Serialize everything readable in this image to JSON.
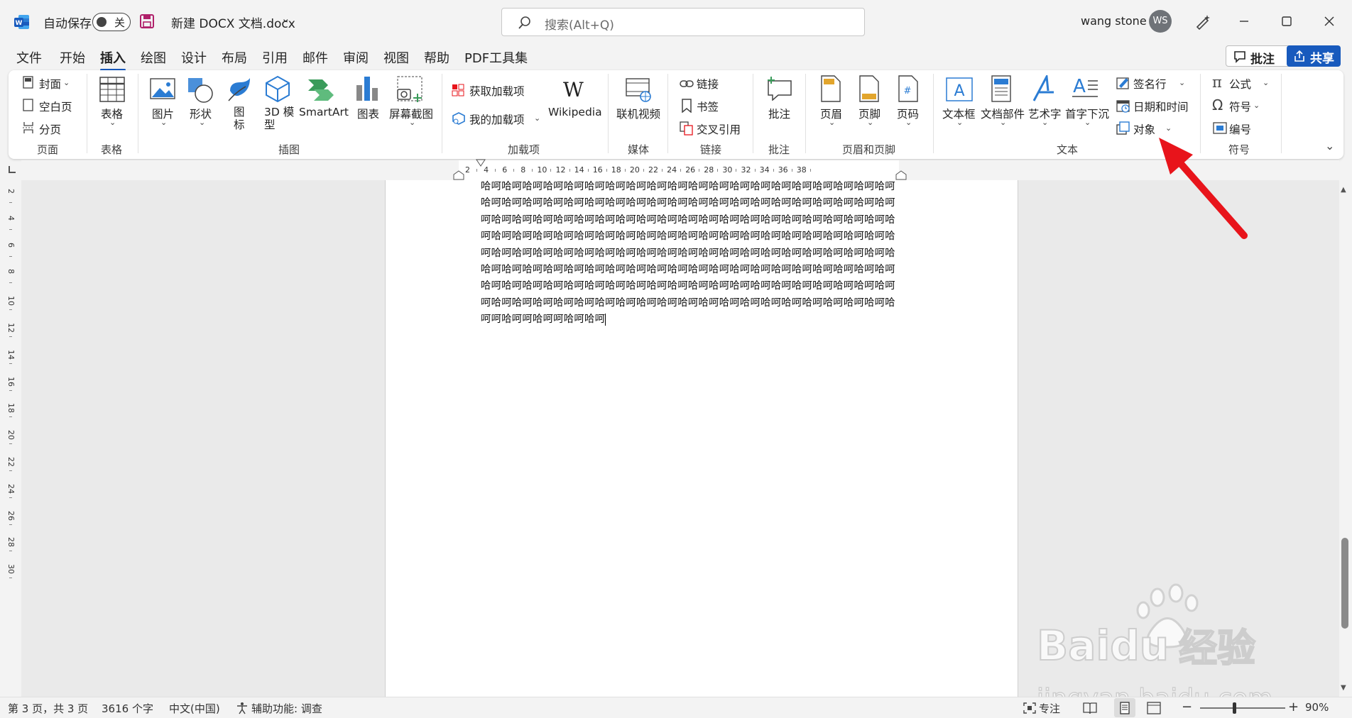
{
  "title_bar": {
    "autosave_label": "自动保存",
    "autosave_state": "关",
    "document_name": "新建 DOCX 文档.docx",
    "search_placeholder": "搜索(Alt+Q)",
    "user_name": "wang stone",
    "user_initials": "WS"
  },
  "menu_tabs": [
    "文件",
    "开始",
    "插入",
    "绘图",
    "设计",
    "布局",
    "引用",
    "邮件",
    "审阅",
    "视图",
    "帮助",
    "PDF工具集"
  ],
  "active_tab": "插入",
  "header_buttons": {
    "comment": "批注",
    "share": "共享"
  },
  "ribbon": {
    "pages": {
      "cover": "封面",
      "blank": "空白页",
      "break": "分页",
      "group": "页面"
    },
    "tables": {
      "table": "表格",
      "group": "表格"
    },
    "illustrations": {
      "picture": "图片",
      "shapes": "形状",
      "icons": "图\n标",
      "model3d": "3D 模\n型",
      "smartart": "SmartArt",
      "chart": "图表",
      "screenshot": "屏幕截图",
      "group": "插图"
    },
    "addins": {
      "get": "获取加载项",
      "my": "我的加载项",
      "wikipedia": "Wikipedia",
      "group": "加载项"
    },
    "media": {
      "video": "联机视频",
      "group": "媒体"
    },
    "links": {
      "link": "链接",
      "bookmark": "书签",
      "crossref": "交叉引用",
      "group": "链接"
    },
    "comments": {
      "comment": "批注",
      "group": "批注"
    },
    "header_footer": {
      "header": "页眉",
      "footer": "页脚",
      "page_number": "页码",
      "group": "页眉和页脚"
    },
    "text": {
      "textbox": "文本框",
      "quickparts": "文档部件",
      "wordart": "艺术字",
      "dropcap": "首字下沉",
      "signature": "签名行",
      "datetime": "日期和时间",
      "object": "对象",
      "group": "文本"
    },
    "symbols": {
      "equation": "公式",
      "symbol": "符号",
      "number": "编号",
      "group": "符号"
    }
  },
  "ruler": {
    "h_ticks": [
      "2",
      "4",
      "6",
      "8",
      "10",
      "12",
      "14",
      "16",
      "18",
      "20",
      "22",
      "24",
      "26",
      "28",
      "30",
      "32",
      "34",
      "36",
      "38"
    ],
    "v_ticks": [
      "2",
      "4",
      "6",
      "8",
      "10",
      "12",
      "14",
      "16",
      "18",
      "20",
      "22",
      "24",
      "26",
      "28",
      "30"
    ]
  },
  "document": {
    "lines": [
      "哈呵哈呵哈呵哈呵哈呵哈呵哈呵哈呵哈呵哈呵哈呵哈呵哈呵哈呵哈呵哈呵哈呵哈呵哈呵哈呵",
      "哈呵哈呵哈呵哈呵哈呵哈呵哈呵哈呵哈呵哈呵哈呵哈呵哈呵哈呵哈呵哈呵哈呵哈呵哈呵哈呵",
      "呵哈呵哈呵哈呵哈呵哈呵哈呵哈呵哈呵哈呵哈呵哈呵哈呵哈呵哈呵哈呵哈呵哈呵哈呵哈呵哈",
      "呵哈呵哈呵哈呵哈呵哈呵哈呵哈呵哈呵哈呵哈呵哈呵哈呵哈呵哈呵哈呵哈呵哈呵哈呵哈呵哈",
      "呵哈呵哈呵哈呵哈呵哈呵哈呵哈呵哈呵哈呵哈呵哈呵哈呵哈呵哈呵哈呵哈呵哈呵哈呵哈呵哈",
      "哈呵哈呵哈呵哈呵哈呵哈呵哈呵哈呵哈呵哈呵哈呵哈呵哈呵哈呵哈呵哈呵哈呵哈呵哈呵哈呵",
      "哈呵哈呵哈呵哈呵哈呵哈呵哈呵哈呵哈呵哈呵哈呵哈呵哈呵哈呵哈呵哈呵哈呵哈呵哈呵哈呵",
      "呵哈呵哈呵哈呵哈呵哈呵哈呵哈呵哈呵哈呵哈呵哈呵哈呵哈呵哈呵哈呵哈呵哈呵哈呵哈呵哈",
      "呵呵哈呵呵哈呵呵哈呵哈呵"
    ]
  },
  "status_bar": {
    "page": "第 3 页，共 3 页",
    "words": "3616 个字",
    "language": "中文(中国)",
    "accessibility": "辅助功能: 调查",
    "focus": "专注",
    "zoom": "90%"
  },
  "watermark": {
    "brand": "Baidu",
    "cn": "经验",
    "url": "jingyan.baidu.com"
  },
  "colors": {
    "accent": "#185abd",
    "arrow": "#e8141b",
    "word_blue": "#185abd"
  }
}
